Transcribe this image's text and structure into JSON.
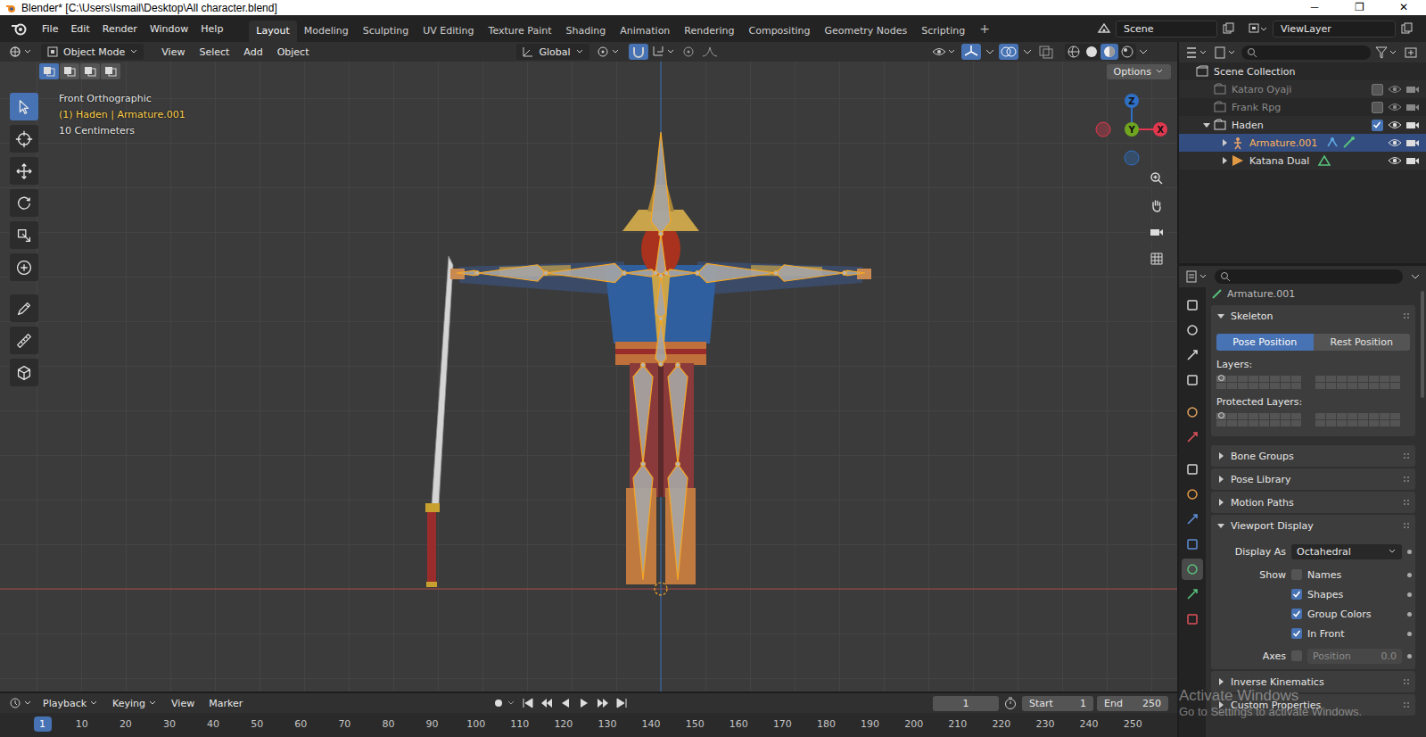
{
  "window": {
    "title": "Blender* [C:\\Users\\Ismail\\Desktop\\All character.blend]",
    "controls": [
      "─",
      "❐",
      "✕"
    ]
  },
  "menu": [
    "File",
    "Edit",
    "Render",
    "Window",
    "Help"
  ],
  "workspaces": [
    {
      "label": "Layout",
      "selected": true
    },
    {
      "label": "Modeling",
      "selected": false
    },
    {
      "label": "Sculpting",
      "selected": false
    },
    {
      "label": "UV Editing",
      "selected": false
    },
    {
      "label": "Texture Paint",
      "selected": false
    },
    {
      "label": "Shading",
      "selected": false
    },
    {
      "label": "Animation",
      "selected": false
    },
    {
      "label": "Rendering",
      "selected": false
    },
    {
      "label": "Compositing",
      "selected": false
    },
    {
      "label": "Geometry Nodes",
      "selected": false
    },
    {
      "label": "Scripting",
      "selected": false
    }
  ],
  "add_workspace": "+",
  "scene": "Scene",
  "view_layer": "ViewLayer",
  "viewport": {
    "mode": "Object Mode",
    "menus": [
      "View",
      "Select",
      "Add",
      "Object"
    ],
    "orientation": "Global",
    "options": "Options",
    "select_modes": [
      {
        "selected": true
      },
      {
        "selected": false
      },
      {
        "selected": false
      },
      {
        "selected": false
      }
    ],
    "info": [
      {
        "text": "Front Orthographic",
        "highlighted": false
      },
      {
        "text": "(1) Haden | Armature.001",
        "highlighted": true
      },
      {
        "text": "10 Centimeters",
        "highlighted": false
      }
    ],
    "tools": [
      {
        "selected": true
      },
      {
        "selected": false
      },
      {
        "selected": false
      },
      {
        "selected": false
      },
      {
        "selected": false
      },
      {
        "selected": false
      },
      {
        "selected": false
      },
      {
        "selected": false
      },
      {
        "selected": false
      }
    ],
    "gizmo": [
      {
        "label": "Z",
        "color": "#2f6fc4"
      },
      {
        "label": "Y",
        "color": "#6fa51f"
      },
      {
        "label": "X",
        "color": "#e0384e"
      }
    ]
  },
  "outliner": {
    "tree": {
      "label": "Scene Collection",
      "kind": "scene",
      "expandable": false,
      "expanded": true,
      "selected": false,
      "children": [
        {
          "label": "Kataro Oyaji",
          "kind": "collection",
          "expandable": false,
          "expanded": false,
          "included": false,
          "visible": true,
          "selected": false,
          "children": []
        },
        {
          "label": "Frank Rpg",
          "kind": "collection",
          "expandable": false,
          "expanded": false,
          "included": false,
          "visible": true,
          "selected": false,
          "children": []
        },
        {
          "label": "Haden",
          "kind": "collection",
          "expandable": true,
          "expanded": true,
          "included": true,
          "visible": true,
          "selected": false,
          "children": [
            {
              "label": "Armature.001",
              "kind": "armature",
              "expandable": true,
              "expanded": false,
              "visible": true,
              "selected": true,
              "children": []
            },
            {
              "label": "Katana Dual",
              "kind": "mesh",
              "expandable": true,
              "expanded": false,
              "visible": true,
              "selected": false,
              "children": []
            }
          ]
        }
      ]
    }
  },
  "properties": {
    "breadcrumb": "Armature.001",
    "tabs": [
      {
        "selected": false
      },
      {
        "selected": false
      },
      {
        "selected": false
      },
      {
        "selected": false
      },
      {
        "selected": false
      },
      {
        "selected": false
      },
      {
        "selected": false
      },
      {
        "selected": false
      },
      {
        "selected": false
      },
      {
        "selected": false
      },
      {
        "selected": true
      },
      {
        "selected": false
      },
      {
        "selected": false
      }
    ],
    "skeleton": {
      "title": "Skeleton",
      "expanded": true,
      "positions": [
        {
          "label": "Pose Position",
          "selected": true
        },
        {
          "label": "Rest Position",
          "selected": false
        }
      ],
      "layers_label": "Layers:",
      "layers": [
        true,
        false,
        false,
        false,
        false,
        false,
        false,
        false,
        false,
        false,
        false,
        false,
        false,
        false,
        false,
        false,
        false,
        false,
        false,
        false,
        false,
        false,
        false,
        false,
        false,
        false,
        false,
        false,
        false,
        false,
        false,
        false
      ],
      "protected_label": "Protected Layers:",
      "protected": [
        true,
        false,
        false,
        false,
        false,
        false,
        false,
        false,
        false,
        false,
        false,
        false,
        false,
        false,
        false,
        false,
        false,
        false,
        false,
        false,
        false,
        false,
        false,
        false,
        false,
        false,
        false,
        false,
        false,
        false,
        false,
        false
      ]
    },
    "collapsed_before": [
      {
        "title": "Bone Groups",
        "expanded": false
      },
      {
        "title": "Pose Library",
        "expanded": false
      },
      {
        "title": "Motion Paths",
        "expanded": false
      }
    ],
    "viewport_display": {
      "title": "Viewport Display",
      "expanded": true,
      "display_as_label": "Display As",
      "display_as": "Octahedral",
      "show_label": "Show",
      "show": [
        {
          "label": "Names",
          "checked": false
        },
        {
          "label": "Shapes",
          "checked": true
        },
        {
          "label": "Group Colors",
          "checked": true
        },
        {
          "label": "In Front",
          "checked": true
        }
      ],
      "axes": {
        "label": "Axes",
        "checked": false,
        "field_label": "Position",
        "field_value": "0.0",
        "disabled": true
      }
    },
    "collapsed_after": [
      {
        "title": "Inverse Kinematics",
        "expanded": false
      },
      {
        "title": "Custom Properties",
        "expanded": false
      }
    ]
  },
  "timeline": {
    "menus": [
      {
        "label": "Playback",
        "dropdown": true
      },
      {
        "label": "Keying",
        "dropdown": true
      },
      {
        "label": "View",
        "dropdown": false
      },
      {
        "label": "Marker",
        "dropdown": false
      }
    ],
    "current_frame": "1",
    "start_label": "Start",
    "start": "1",
    "end_label": "End",
    "end": "250",
    "ruler_current": "1",
    "ruler": [
      "10",
      "20",
      "30",
      "40",
      "50",
      "60",
      "70",
      "80",
      "90",
      "100",
      "110",
      "120",
      "130",
      "140",
      "150",
      "160",
      "170",
      "180",
      "190",
      "200",
      "210",
      "220",
      "230",
      "240",
      "250"
    ]
  },
  "watermark": {
    "title": "Activate Windows",
    "subtitle": "Go to Settings to activate Windows."
  }
}
